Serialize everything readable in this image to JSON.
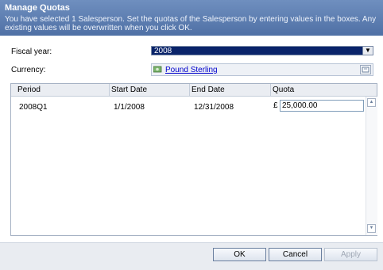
{
  "dialog": {
    "title": "Manage Quotas",
    "description": "You have selected 1 Salesperson. Set the quotas of the Salesperson by entering values in the boxes. Any existing values will be overwritten when you click OK."
  },
  "fiscal_year": {
    "label": "Fiscal year:",
    "value": "2008"
  },
  "currency": {
    "label": "Currency:",
    "value": "Pound Sterling"
  },
  "grid": {
    "headers": [
      "Period",
      "Start Date",
      "End Date",
      "Quota"
    ],
    "rows": [
      {
        "period": "2008Q1",
        "start": "1/1/2008",
        "end": "12/31/2008",
        "currency_symbol": "£",
        "quota": "25,000.00"
      }
    ]
  },
  "buttons": {
    "ok": "OK",
    "cancel": "Cancel",
    "apply": "Apply"
  }
}
